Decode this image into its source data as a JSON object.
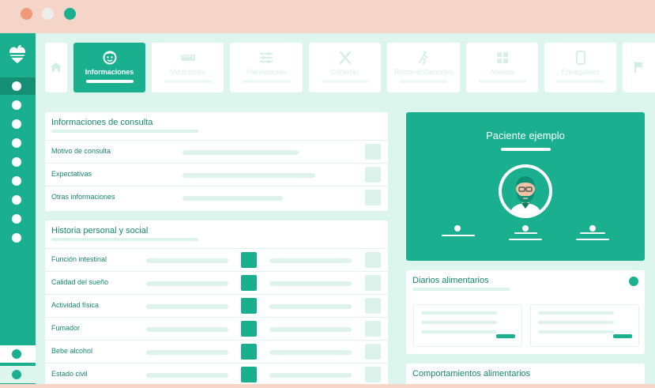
{
  "tabs": [
    {
      "label": "Informaciones",
      "icon": "face-icon",
      "active": true
    },
    {
      "label": "Mediciones",
      "icon": "ruler-icon",
      "active": false
    },
    {
      "label": "Planificación",
      "icon": "sliders-icon",
      "active": false
    },
    {
      "label": "Comidas",
      "icon": "utensils-icon",
      "active": false
    },
    {
      "label": "Recomendaciones",
      "icon": "running-icon",
      "active": false
    },
    {
      "label": "Análisis",
      "icon": "grid-icon",
      "active": false
    },
    {
      "label": "Entregables",
      "icon": "phone-icon",
      "active": false
    }
  ],
  "consulta": {
    "title": "Informaciones de consulta",
    "rows": [
      "Motivo de consulta",
      "Expectativas",
      "Otras informaciones"
    ]
  },
  "historia": {
    "title": "Historia personal y social",
    "rows": [
      "Función intestinal",
      "Calidad del sueño",
      "Actividad física",
      "Fumador",
      "Bebe alcohol",
      "Estado civil"
    ]
  },
  "patient": {
    "name": "Paciente ejemplo"
  },
  "diarios": {
    "title": "Diarios alimentarios"
  },
  "comportamientos": {
    "title": "Comportamientos alimentarios"
  },
  "colors": {
    "accent": "#1ab08f",
    "accent_dark": "#16876e",
    "background": "#dcf6ee",
    "titlebar": "#f6d5c9"
  }
}
